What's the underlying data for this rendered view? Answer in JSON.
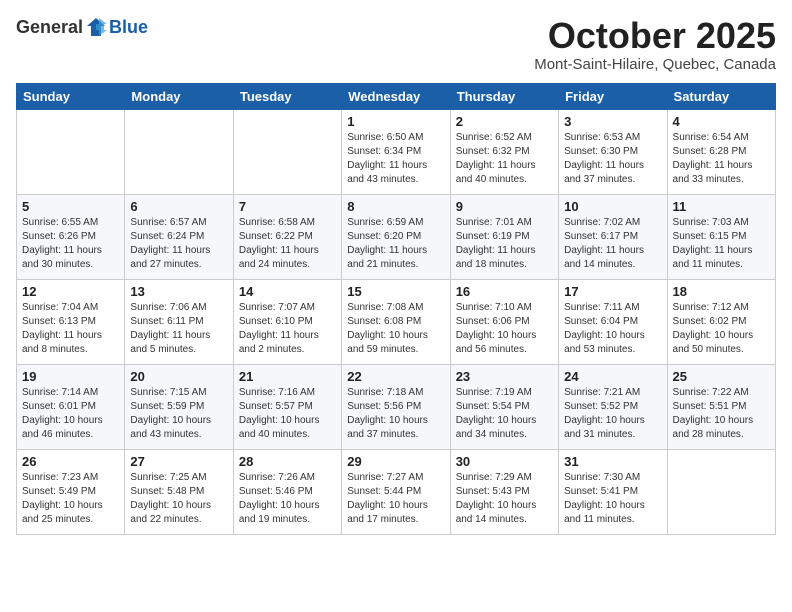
{
  "header": {
    "logo_general": "General",
    "logo_blue": "Blue",
    "title": "October 2025",
    "subtitle": "Mont-Saint-Hilaire, Quebec, Canada"
  },
  "days": [
    "Sunday",
    "Monday",
    "Tuesday",
    "Wednesday",
    "Thursday",
    "Friday",
    "Saturday"
  ],
  "weeks": [
    [
      {
        "date": "",
        "info": ""
      },
      {
        "date": "",
        "info": ""
      },
      {
        "date": "",
        "info": ""
      },
      {
        "date": "1",
        "info": "Sunrise: 6:50 AM\nSunset: 6:34 PM\nDaylight: 11 hours\nand 43 minutes."
      },
      {
        "date": "2",
        "info": "Sunrise: 6:52 AM\nSunset: 6:32 PM\nDaylight: 11 hours\nand 40 minutes."
      },
      {
        "date": "3",
        "info": "Sunrise: 6:53 AM\nSunset: 6:30 PM\nDaylight: 11 hours\nand 37 minutes."
      },
      {
        "date": "4",
        "info": "Sunrise: 6:54 AM\nSunset: 6:28 PM\nDaylight: 11 hours\nand 33 minutes."
      }
    ],
    [
      {
        "date": "5",
        "info": "Sunrise: 6:55 AM\nSunset: 6:26 PM\nDaylight: 11 hours\nand 30 minutes."
      },
      {
        "date": "6",
        "info": "Sunrise: 6:57 AM\nSunset: 6:24 PM\nDaylight: 11 hours\nand 27 minutes."
      },
      {
        "date": "7",
        "info": "Sunrise: 6:58 AM\nSunset: 6:22 PM\nDaylight: 11 hours\nand 24 minutes."
      },
      {
        "date": "8",
        "info": "Sunrise: 6:59 AM\nSunset: 6:20 PM\nDaylight: 11 hours\nand 21 minutes."
      },
      {
        "date": "9",
        "info": "Sunrise: 7:01 AM\nSunset: 6:19 PM\nDaylight: 11 hours\nand 18 minutes."
      },
      {
        "date": "10",
        "info": "Sunrise: 7:02 AM\nSunset: 6:17 PM\nDaylight: 11 hours\nand 14 minutes."
      },
      {
        "date": "11",
        "info": "Sunrise: 7:03 AM\nSunset: 6:15 PM\nDaylight: 11 hours\nand 11 minutes."
      }
    ],
    [
      {
        "date": "12",
        "info": "Sunrise: 7:04 AM\nSunset: 6:13 PM\nDaylight: 11 hours\nand 8 minutes."
      },
      {
        "date": "13",
        "info": "Sunrise: 7:06 AM\nSunset: 6:11 PM\nDaylight: 11 hours\nand 5 minutes."
      },
      {
        "date": "14",
        "info": "Sunrise: 7:07 AM\nSunset: 6:10 PM\nDaylight: 11 hours\nand 2 minutes."
      },
      {
        "date": "15",
        "info": "Sunrise: 7:08 AM\nSunset: 6:08 PM\nDaylight: 10 hours\nand 59 minutes."
      },
      {
        "date": "16",
        "info": "Sunrise: 7:10 AM\nSunset: 6:06 PM\nDaylight: 10 hours\nand 56 minutes."
      },
      {
        "date": "17",
        "info": "Sunrise: 7:11 AM\nSunset: 6:04 PM\nDaylight: 10 hours\nand 53 minutes."
      },
      {
        "date": "18",
        "info": "Sunrise: 7:12 AM\nSunset: 6:02 PM\nDaylight: 10 hours\nand 50 minutes."
      }
    ],
    [
      {
        "date": "19",
        "info": "Sunrise: 7:14 AM\nSunset: 6:01 PM\nDaylight: 10 hours\nand 46 minutes."
      },
      {
        "date": "20",
        "info": "Sunrise: 7:15 AM\nSunset: 5:59 PM\nDaylight: 10 hours\nand 43 minutes."
      },
      {
        "date": "21",
        "info": "Sunrise: 7:16 AM\nSunset: 5:57 PM\nDaylight: 10 hours\nand 40 minutes."
      },
      {
        "date": "22",
        "info": "Sunrise: 7:18 AM\nSunset: 5:56 PM\nDaylight: 10 hours\nand 37 minutes."
      },
      {
        "date": "23",
        "info": "Sunrise: 7:19 AM\nSunset: 5:54 PM\nDaylight: 10 hours\nand 34 minutes."
      },
      {
        "date": "24",
        "info": "Sunrise: 7:21 AM\nSunset: 5:52 PM\nDaylight: 10 hours\nand 31 minutes."
      },
      {
        "date": "25",
        "info": "Sunrise: 7:22 AM\nSunset: 5:51 PM\nDaylight: 10 hours\nand 28 minutes."
      }
    ],
    [
      {
        "date": "26",
        "info": "Sunrise: 7:23 AM\nSunset: 5:49 PM\nDaylight: 10 hours\nand 25 minutes."
      },
      {
        "date": "27",
        "info": "Sunrise: 7:25 AM\nSunset: 5:48 PM\nDaylight: 10 hours\nand 22 minutes."
      },
      {
        "date": "28",
        "info": "Sunrise: 7:26 AM\nSunset: 5:46 PM\nDaylight: 10 hours\nand 19 minutes."
      },
      {
        "date": "29",
        "info": "Sunrise: 7:27 AM\nSunset: 5:44 PM\nDaylight: 10 hours\nand 17 minutes."
      },
      {
        "date": "30",
        "info": "Sunrise: 7:29 AM\nSunset: 5:43 PM\nDaylight: 10 hours\nand 14 minutes."
      },
      {
        "date": "31",
        "info": "Sunrise: 7:30 AM\nSunset: 5:41 PM\nDaylight: 10 hours\nand 11 minutes."
      },
      {
        "date": "",
        "info": ""
      }
    ]
  ],
  "colors": {
    "header_bg": "#1a5fa8",
    "header_text": "#ffffff",
    "logo_blue": "#1a5fa8"
  }
}
